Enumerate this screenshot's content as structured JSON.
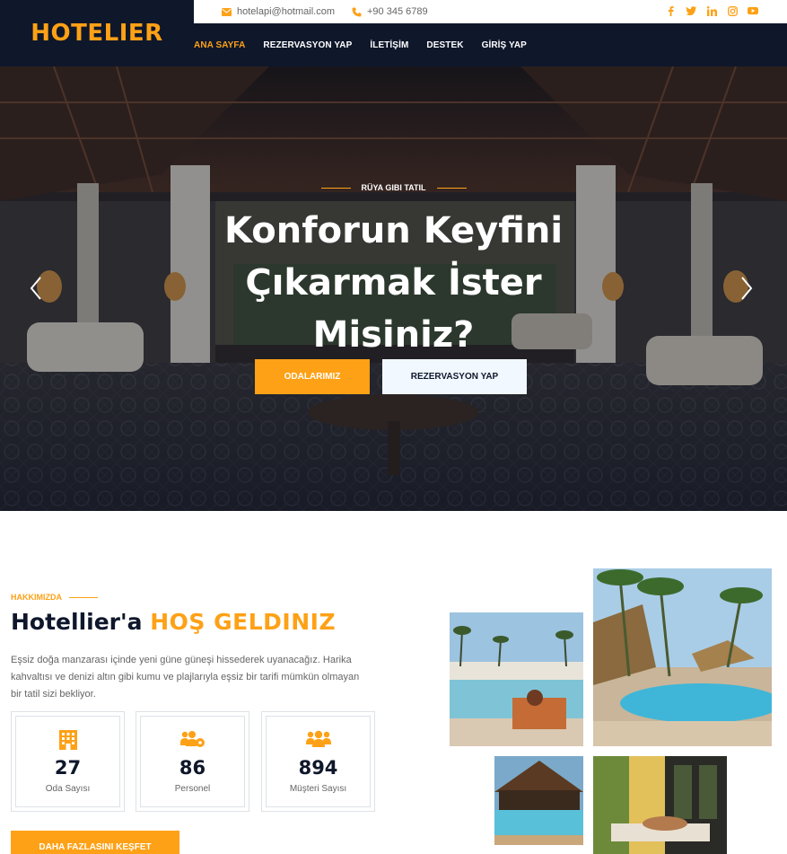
{
  "brand": {
    "logo": "HOTELIER",
    "accent": "#fea116",
    "dark": "#0f172b"
  },
  "topbar": {
    "email": "hotelapi@hotmail.com",
    "phone": "+90 345 6789",
    "email_icon": "envelope-icon",
    "phone_icon": "phone-icon",
    "socials": [
      "facebook-icon",
      "twitter-icon",
      "linkedin-icon",
      "instagram-icon",
      "youtube-icon"
    ]
  },
  "nav": {
    "items": [
      {
        "label": "ANA SAYFA",
        "active": true
      },
      {
        "label": "REZERVASYON YAP"
      },
      {
        "label": "İLETİŞİM"
      },
      {
        "label": "DESTEK"
      },
      {
        "label": "GİRİŞ YAP"
      }
    ]
  },
  "hero": {
    "eyebrow": "RÜYA GIBI TATIL",
    "title_line1": "Konforun Keyfini",
    "title_line2": "Çıkarmak İster",
    "title_line3": "Misiniz?",
    "primary_button": "ODALARIMIZ",
    "secondary_button": "REZERVASYON YAP",
    "prev_icon": "chevron-left-icon",
    "next_icon": "chevron-right-icon"
  },
  "about": {
    "eyebrow": "HAKKIMIZDA",
    "title_prefix": "Hotellier'a",
    "title_highlight": "HOŞ GELDINIZ",
    "text": "Eşsiz doğa manzarası içinde yeni güne güneşi hissederek uyanacağız. Harika kahvaltısı ve denizi altın gibi kumu ve plajlarıyla eşsiz bir tarifi mümkün olmayan bir tatil sizi bekliyor.",
    "stats": [
      {
        "icon": "hotel-icon",
        "value": "27",
        "label": "Oda Sayısı"
      },
      {
        "icon": "users-cog-icon",
        "value": "86",
        "label": "Personel"
      },
      {
        "icon": "users-icon",
        "value": "894",
        "label": "Müşteri Sayısı"
      }
    ],
    "cta": "DAHA FAZLASINI KEŞFET"
  }
}
